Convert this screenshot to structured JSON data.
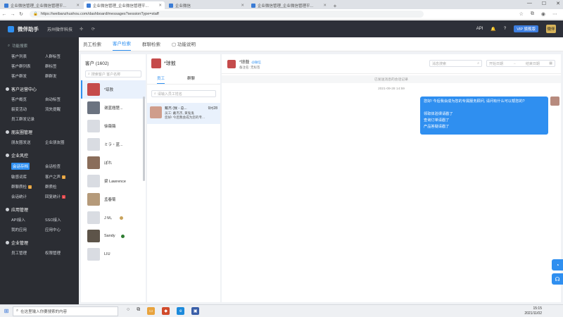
{
  "browser": {
    "tabs": [
      {
        "title": "企业微信管理_企业微信管理平...",
        "active": false
      },
      {
        "title": "企业微信管理_企业微信管理平...",
        "active": true
      },
      {
        "title": "企业微信",
        "active": false
      },
      {
        "title": "企业微信管理_企业微信管理平...",
        "active": false
      }
    ],
    "url": "https://weibanzhushou.com/dashboard/messages?sessionType=staff"
  },
  "header": {
    "app_title": "微伴助手",
    "org": "苏州微伴科技",
    "icons": [
      "sync-icon",
      "refresh-icon"
    ],
    "right": {
      "api": "API",
      "vip": "VIP 旗舰版",
      "avatar": "微伴"
    }
  },
  "sidebar": {
    "search_placeholder": "功能搜索",
    "groups": [
      {
        "title": "",
        "items": [
          "客户列表",
          "人群标签",
          "客户群列表",
          "群标签",
          "客户群发",
          "群群发"
        ]
      },
      {
        "title": "客户运营中心",
        "items": [
          "客户概览",
          "自动标签",
          "裂变活动",
          "流失提醒",
          "员工群发记录"
        ]
      },
      {
        "title": "朋友圈管理",
        "items": [
          "朋友圈发送",
          "企业朋友圈"
        ]
      },
      {
        "title": "企业风控",
        "items": [
          "会话存档",
          "会话检查",
          "敏感词库",
          "客户之声",
          "群聊质检",
          "群质检",
          "会话统计",
          "回复统计"
        ]
      },
      {
        "title": "应用管理",
        "items": [
          "API接入",
          "SSO接入",
          "我的应用",
          "应用中心"
        ]
      },
      {
        "title": "企业管理",
        "items": [
          "员工管理",
          "权限管理"
        ]
      }
    ]
  },
  "tabs": [
    {
      "label": "员工检索",
      "active": false
    },
    {
      "label": "客户检索",
      "active": true
    },
    {
      "label": "群聊检索",
      "active": false
    },
    {
      "label": "功能说明",
      "active": false
    }
  ],
  "customers": {
    "title": "客户 (1602)",
    "search_placeholder": "搜索客户 客户名称",
    "list": [
      {
        "name": "*琼敖",
        "active": true,
        "presence": false
      },
      {
        "name": "谢蓝翘楚...",
        "active": false,
        "presence": false
      },
      {
        "name": "徐薇薇",
        "active": false,
        "presence": false
      },
      {
        "name": "ミラ・蓝...",
        "active": false,
        "presence": false
      },
      {
        "name": "ぽれ",
        "active": false,
        "presence": false
      },
      {
        "name": "梁 Lawrence",
        "active": false,
        "presence": false
      },
      {
        "name": "孟春菊",
        "active": false,
        "presence": false
      },
      {
        "name": "J M。",
        "active": false,
        "presence": true
      },
      {
        "name": "Sandy",
        "active": false,
        "presence": true
      },
      {
        "name": "LIU",
        "active": false,
        "presence": false
      }
    ]
  },
  "middle": {
    "name": "*琼敖",
    "tabs": [
      {
        "label": "员工",
        "active": true
      },
      {
        "label": "群聊",
        "active": false
      }
    ],
    "search_placeholder": "请输入员工姓名",
    "conversation": {
      "name": "戴杰 (我 - 总...",
      "time": "9月28",
      "line1": "员工: 戴杰杰, 黄鬼鬼",
      "line2": "您好! 今后我会成为您的专..."
    }
  },
  "chat": {
    "name": "*琼敖",
    "tag": "@微信",
    "sub": "备注名: 无标签",
    "search_placeholder": "消息搜索",
    "date_start": "开始日期",
    "date_sep": "→",
    "date_end": "结束日期",
    "notice": "已发送消息的会话记录",
    "time": "2021-09-28 14:59",
    "message_lines": [
      "您好! 今后我会成为您的专属服务顾问, 请问有什么可以帮您的?",
      "",
      "领取体验课请戳了",
      "查询订单请戳了",
      "产品答疑请戳了"
    ]
  },
  "taskbar": {
    "search_placeholder": "在这里输入你要搜索的内容",
    "time": "15:15",
    "date": "2021/11/02"
  }
}
